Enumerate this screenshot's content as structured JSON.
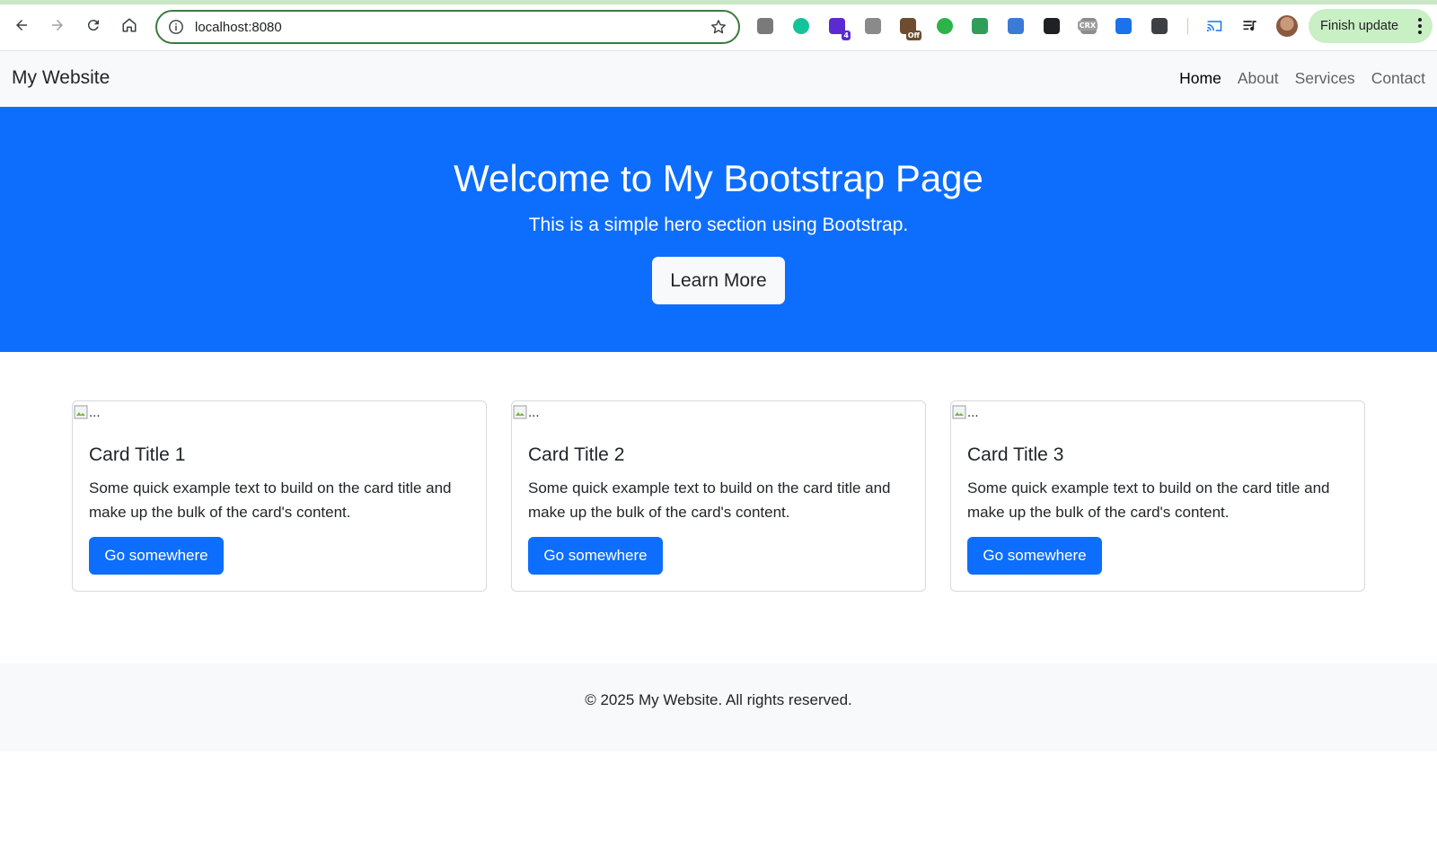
{
  "browser": {
    "url": "localhost:8080",
    "finish_update_label": "Finish update",
    "extensions": [
      {
        "name": "puzzle-ext-icon",
        "color": "#7a7a7a"
      },
      {
        "name": "grammarly-icon",
        "color": "#15c39a"
      },
      {
        "name": "hat-ext-icon",
        "color": "#5b2bd1",
        "badge": "4"
      },
      {
        "name": "camera-ext-icon",
        "color": "#8a8a8a"
      },
      {
        "name": "toggle-ext-icon",
        "color": "#6d4c2f",
        "badge": "Off"
      },
      {
        "name": "shield-ext-icon",
        "color": "#2cb34a"
      },
      {
        "name": "robot-ext-icon",
        "color": "#2e9e5b"
      },
      {
        "name": "color-wheel-ext-icon",
        "color": "#3a7bd5"
      },
      {
        "name": "dark-ext-icon",
        "color": "#202124"
      },
      {
        "name": "crx-ext-icon",
        "color": "#8c8c8c",
        "badge": "CRX"
      },
      {
        "name": "blue-puzzle-ext-icon",
        "color": "#1a73e8"
      },
      {
        "name": "extensions-icon",
        "color": "#3c4043"
      }
    ]
  },
  "navbar": {
    "brand": "My Website",
    "links": [
      {
        "label": "Home",
        "active": true
      },
      {
        "label": "About",
        "active": false
      },
      {
        "label": "Services",
        "active": false
      },
      {
        "label": "Contact",
        "active": false
      }
    ]
  },
  "hero": {
    "title": "Welcome to My Bootstrap Page",
    "subtitle": "This is a simple hero section using Bootstrap.",
    "button_label": "Learn More"
  },
  "cards": [
    {
      "img_alt": "...",
      "title": "Card Title 1",
      "text": "Some quick example text to build on the card title and make up the bulk of the card's content.",
      "button_label": "Go somewhere"
    },
    {
      "img_alt": "...",
      "title": "Card Title 2",
      "text": "Some quick example text to build on the card title and make up the bulk of the card's content.",
      "button_label": "Go somewhere"
    },
    {
      "img_alt": "...",
      "title": "Card Title 3",
      "text": "Some quick example text to build on the card title and make up the bulk of the card's content.",
      "button_label": "Go somewhere"
    }
  ],
  "footer": {
    "text": "© 2025 My Website. All rights reserved."
  },
  "colors": {
    "primary": "#0d6efd",
    "light": "#f8f9fa",
    "omnibox_border": "#3c7a3e",
    "update_pill": "#c9efc4"
  }
}
